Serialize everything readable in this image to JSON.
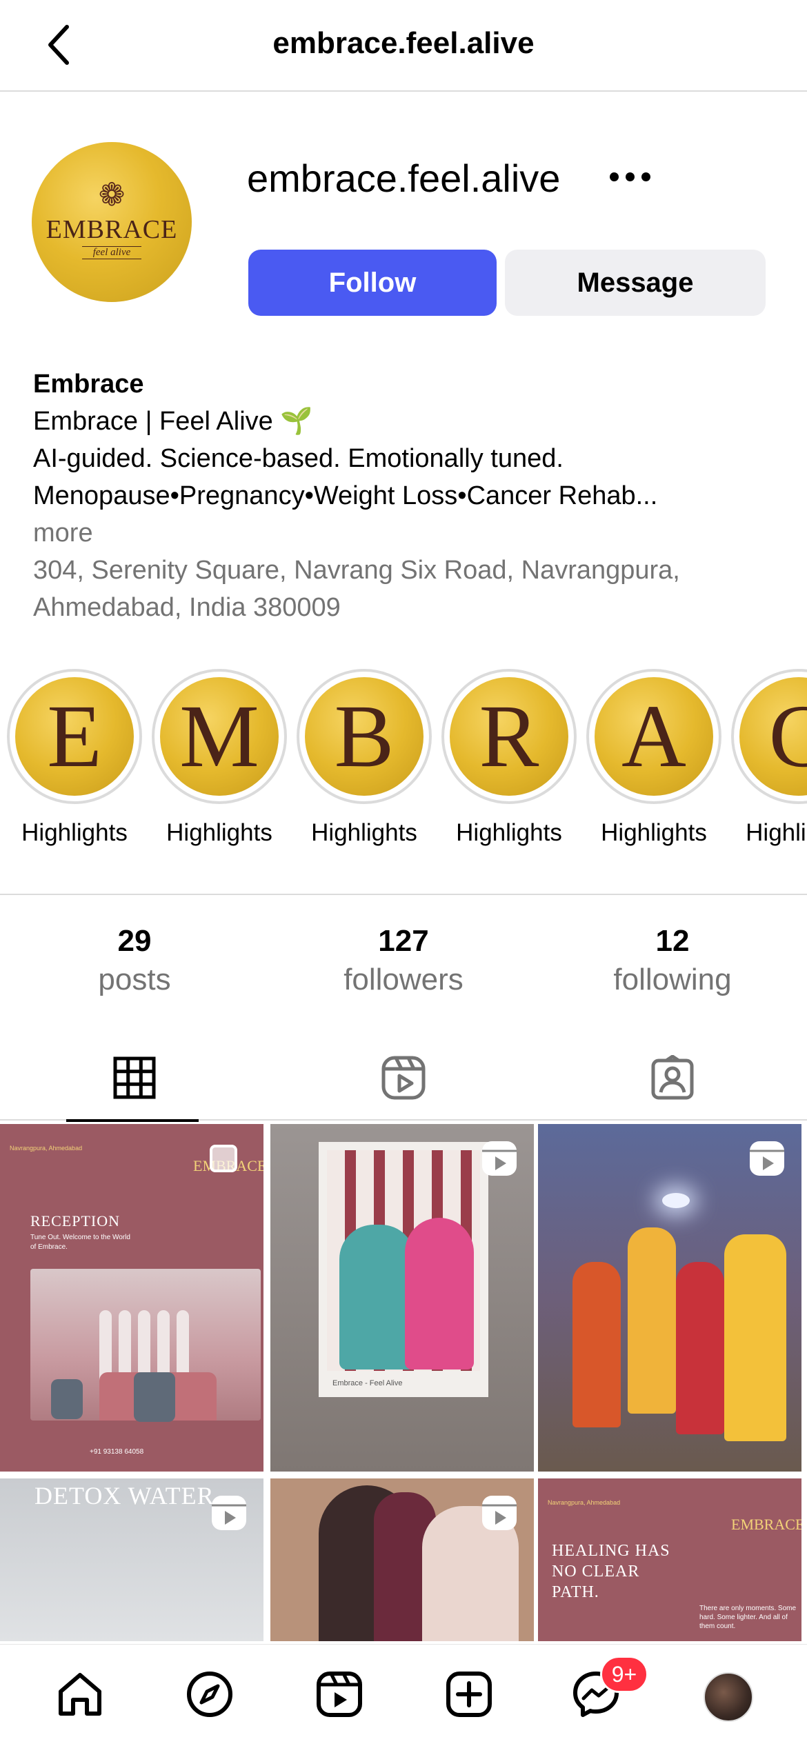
{
  "topbar": {
    "title": "embrace.feel.alive"
  },
  "profile": {
    "avatar_brand": "EMBRACE",
    "avatar_sub": "feel alive",
    "username": "embrace.feel.alive",
    "follow_label": "Follow",
    "message_label": "Message"
  },
  "bio": {
    "name": "Embrace",
    "line1": "Embrace | Feel Alive 🌱",
    "line2": "AI-guided. Science-based. Emotionally tuned.",
    "line3": "Menopause•Pregnancy•Weight Loss•Cancer Rehab...",
    "more": "more",
    "address1": "304, Serenity Square, Navrang Six Road, Navrangpura,",
    "address2": "Ahmedabad, India 380009"
  },
  "highlights": [
    {
      "letter": "E",
      "label": "Highlights"
    },
    {
      "letter": "M",
      "label": "Highlights"
    },
    {
      "letter": "B",
      "label": "Highlights"
    },
    {
      "letter": "R",
      "label": "Highlights"
    },
    {
      "letter": "A",
      "label": "Highlights"
    },
    {
      "letter": "C",
      "label": "Highlights"
    }
  ],
  "stats": [
    {
      "value": "29",
      "label": "posts"
    },
    {
      "value": "127",
      "label": "followers"
    },
    {
      "value": "12",
      "label": "following"
    }
  ],
  "tabs": [
    "grid-icon",
    "reels-icon",
    "tagged-icon"
  ],
  "posts": {
    "p1": {
      "location": "Navrangpura, Ahmedabad",
      "logo": "EMBRACE",
      "heading": "RECEPTION",
      "desc": "Tune Out. Welcome to the World of Embrace.",
      "phone": "+91 93138 64058"
    },
    "p2": {
      "caption": "Embrace - Feel Alive"
    },
    "p4": {
      "title": "DETOX WATER"
    },
    "p6": {
      "location": "Navrangpura, Ahmedabad",
      "logo": "EMBRACE",
      "heading": "HEALING HAS NO CLEAR PATH.",
      "note": "There are only moments. Some hard. Some lighter. And all of them count."
    }
  },
  "nav": {
    "badge": "9+"
  },
  "colors": {
    "follow": "#4a5af2",
    "gold": "#e5b92d",
    "badge": "#ff3040",
    "muted": "#737373"
  }
}
